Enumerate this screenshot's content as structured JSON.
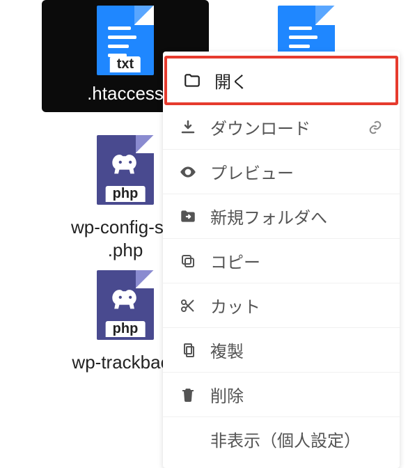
{
  "files": {
    "htaccess": {
      "name": ".htaccess",
      "badge": "txt"
    },
    "secondDoc": {
      "name": "",
      "badge": ""
    },
    "wpconfig": {
      "name": "wp-config-sar\n.php",
      "badge": "php"
    },
    "wptrackback": {
      "name": "wp-trackback",
      "badge": "php"
    }
  },
  "menu": {
    "open": "開く",
    "download": "ダウンロード",
    "preview": "プレビュー",
    "newFolder": "新規フォルダへ",
    "copy": "コピー",
    "cut": "カット",
    "duplicate": "複製",
    "delete": "削除",
    "hide": "非表示（個人設定）"
  }
}
